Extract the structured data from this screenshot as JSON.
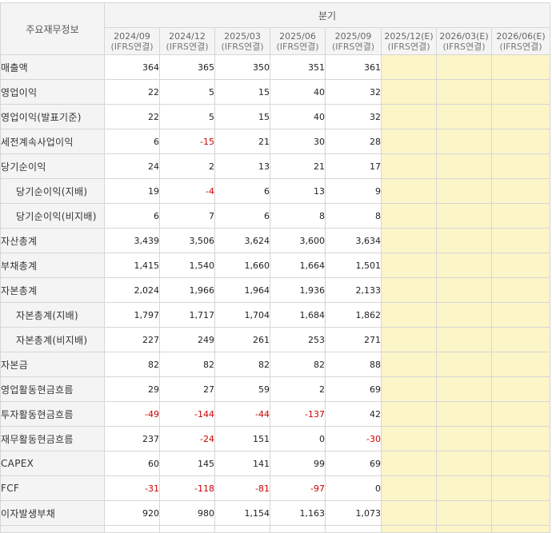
{
  "table": {
    "corner_label": "주요재무정보",
    "group_label": "분기",
    "periods": [
      {
        "date": "2024/09",
        "basis": "(IFRS연결)",
        "estimate": false
      },
      {
        "date": "2024/12",
        "basis": "(IFRS연결)",
        "estimate": false
      },
      {
        "date": "2025/03",
        "basis": "(IFRS연결)",
        "estimate": false
      },
      {
        "date": "2025/06",
        "basis": "(IFRS연결)",
        "estimate": false
      },
      {
        "date": "2025/09",
        "basis": "(IFRS연결)",
        "estimate": false
      },
      {
        "date": "2025/12(E)",
        "basis": "(IFRS연결)",
        "estimate": true
      },
      {
        "date": "2026/03(E)",
        "basis": "(IFRS연결)",
        "estimate": true
      },
      {
        "date": "2026/06(E)",
        "basis": "(IFRS연결)",
        "estimate": true
      }
    ],
    "rows": [
      {
        "label": "매출액",
        "indent": false,
        "values": [
          "364",
          "365",
          "350",
          "351",
          "361"
        ]
      },
      {
        "label": "영업이익",
        "indent": false,
        "values": [
          "22",
          "5",
          "15",
          "40",
          "32"
        ]
      },
      {
        "label": "영업이익(발표기준)",
        "indent": false,
        "values": [
          "22",
          "5",
          "15",
          "40",
          "32"
        ]
      },
      {
        "label": "세전계속사업이익",
        "indent": false,
        "values": [
          "6",
          "-15",
          "21",
          "30",
          "28"
        ]
      },
      {
        "label": "당기순이익",
        "indent": false,
        "values": [
          "24",
          "2",
          "13",
          "21",
          "17"
        ]
      },
      {
        "label": "당기순이익(지배)",
        "indent": true,
        "values": [
          "19",
          "-4",
          "6",
          "13",
          "9"
        ]
      },
      {
        "label": "당기순이익(비지배)",
        "indent": true,
        "values": [
          "6",
          "7",
          "6",
          "8",
          "8"
        ]
      },
      {
        "label": "자산총계",
        "indent": false,
        "values": [
          "3,439",
          "3,506",
          "3,624",
          "3,600",
          "3,634"
        ]
      },
      {
        "label": "부채총계",
        "indent": false,
        "values": [
          "1,415",
          "1,540",
          "1,660",
          "1,664",
          "1,501"
        ]
      },
      {
        "label": "자본총계",
        "indent": false,
        "values": [
          "2,024",
          "1,966",
          "1,964",
          "1,936",
          "2,133"
        ]
      },
      {
        "label": "자본총계(지배)",
        "indent": true,
        "values": [
          "1,797",
          "1,717",
          "1,704",
          "1,684",
          "1,862"
        ]
      },
      {
        "label": "자본총계(비지배)",
        "indent": true,
        "values": [
          "227",
          "249",
          "261",
          "253",
          "271"
        ]
      },
      {
        "label": "자본금",
        "indent": false,
        "values": [
          "82",
          "82",
          "82",
          "82",
          "88"
        ]
      },
      {
        "label": "영업활동현금흐름",
        "indent": false,
        "values": [
          "29",
          "27",
          "59",
          "2",
          "69"
        ]
      },
      {
        "label": "투자활동현금흐름",
        "indent": false,
        "values": [
          "-49",
          "-144",
          "-44",
          "-137",
          "42"
        ]
      },
      {
        "label": "재무활동현금흐름",
        "indent": false,
        "values": [
          "237",
          "-24",
          "151",
          "0",
          "-30"
        ]
      },
      {
        "label": "CAPEX",
        "indent": false,
        "values": [
          "60",
          "145",
          "141",
          "99",
          "69"
        ]
      },
      {
        "label": "FCF",
        "indent": false,
        "values": [
          "-31",
          "-118",
          "-81",
          "-97",
          "0"
        ]
      },
      {
        "label": "이자발생부채",
        "indent": false,
        "values": [
          "920",
          "980",
          "1,154",
          "1,163",
          "1,073"
        ]
      }
    ],
    "colors": {
      "header_bg": "#f4f4f4",
      "estimate_bg": "#fbf5c8",
      "negative": "#cc0000",
      "border": "#d6d6d6"
    }
  }
}
